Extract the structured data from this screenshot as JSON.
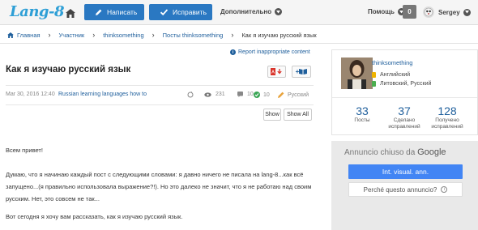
{
  "navbar": {
    "logo": "Lang-8",
    "write_label": "Написать",
    "correct_label": "Исправить",
    "more_label": "Дополнительно",
    "help_label": "Помощь",
    "notifications_count": "0",
    "username": "Sergey"
  },
  "breadcrumb": {
    "items": [
      "Главная",
      "Участник",
      "thinksomething",
      "Посты thinksomething"
    ],
    "current": "Как я изучаю русский язык"
  },
  "post": {
    "report_link": "Report inappropriate content",
    "title": "Как я изучаю русский язык",
    "bookmark_label": "+",
    "date": "Mar 30, 2016 12:40",
    "tags": "Russian learning languages how to",
    "views": "231",
    "comments": "10",
    "corrections": "10",
    "language": "Русский",
    "show_label": "Show",
    "show_all_label": "Show All",
    "paragraphs": [
      "Всем привет!",
      "Думаю, что я начинаю каждый пост с следующими словами: я давно ничего не писала на lang-8...как всё запущено...(я правильно использовала выражение?!). Но это далеко не значит, что я не работаю над своим русским. Нет, это совсем не так...",
      "Вот сегодня я хочу вам рассказать, как я изучаю русский язык."
    ]
  },
  "profile": {
    "name": "thinksomething",
    "native_language": "Английский",
    "learning_languages": "Литовский, Русский",
    "stats": [
      {
        "value": "33",
        "label_lines": [
          "Посты"
        ]
      },
      {
        "value": "37",
        "label_lines": [
          "Сделано",
          "исправлений"
        ]
      },
      {
        "value": "128",
        "label_lines": [
          "Получено",
          "исправлений"
        ]
      }
    ],
    "native_color": "#f0b400",
    "learning_color": "#4caf50"
  },
  "ad": {
    "title": "Annuncio chiuso da",
    "brand": "Google",
    "button_label": "Int. visual. ann.",
    "why_label": "Perché questo annuncio?"
  },
  "colors": {
    "brand_blue": "#2a78c2",
    "link_blue": "#1f5f9c",
    "google_blue": "#4285f4"
  }
}
